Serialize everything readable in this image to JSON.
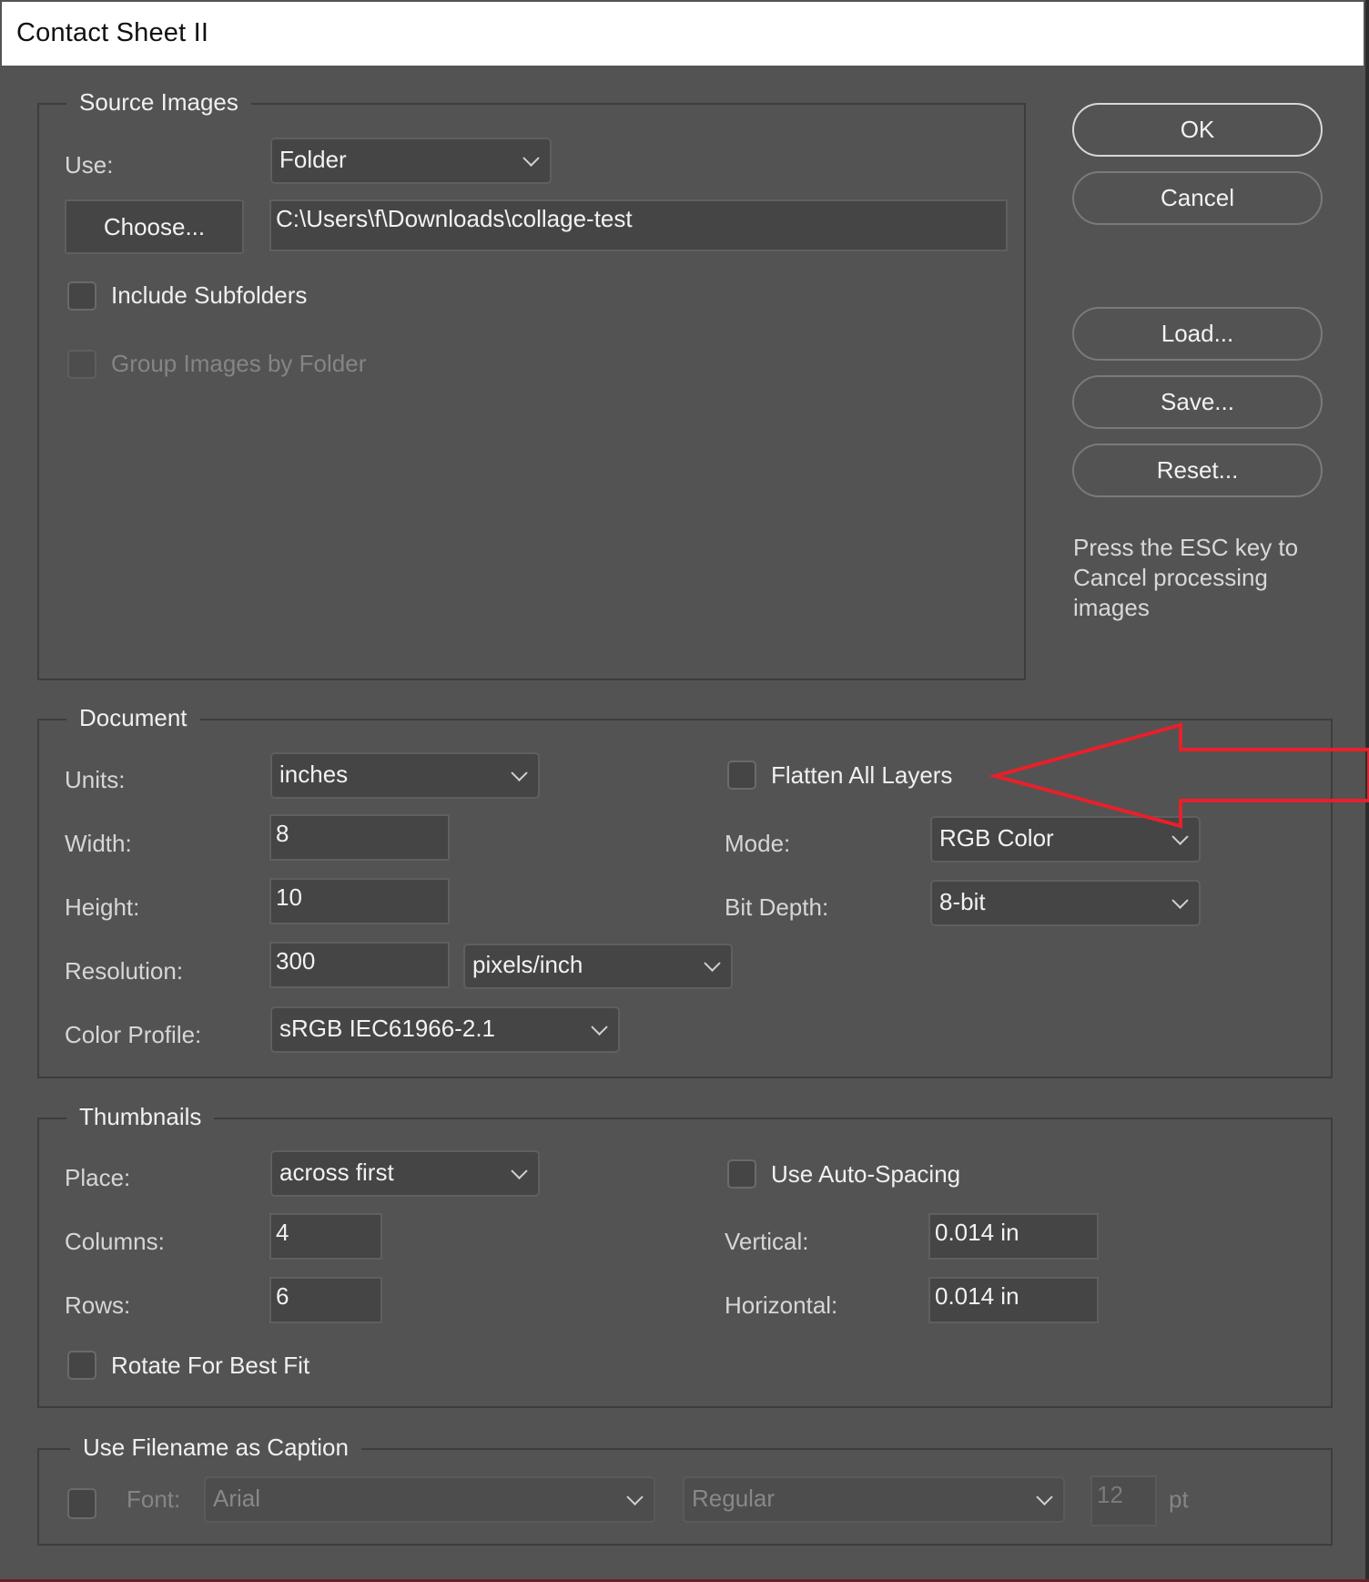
{
  "window": {
    "title": "Contact Sheet II"
  },
  "source_images": {
    "title": "Source Images",
    "use_label": "Use:",
    "use_value": "Folder",
    "choose_label": "Choose...",
    "path_value": "C:\\Users\\f\\Downloads\\collage-test",
    "include_subfolders": {
      "label": "Include Subfolders",
      "checked": false
    },
    "group_by_folder": {
      "label": "Group Images by Folder",
      "checked": false,
      "enabled": false
    }
  },
  "actions": {
    "ok": "OK",
    "cancel": "Cancel",
    "load": "Load...",
    "save": "Save...",
    "reset": "Reset...",
    "esc_note": "Press the ESC key to Cancel processing images"
  },
  "document": {
    "title": "Document",
    "units_label": "Units:",
    "units_value": "inches",
    "width_label": "Width:",
    "width_value": "8",
    "height_label": "Height:",
    "height_value": "10",
    "resolution_label": "Resolution:",
    "resolution_value": "300",
    "resolution_unit": "pixels/inch",
    "color_profile_label": "Color Profile:",
    "color_profile_value": "sRGB IEC61966-2.1",
    "flatten": {
      "label": "Flatten All Layers",
      "checked": false
    },
    "mode_label": "Mode:",
    "mode_value": "RGB Color",
    "bit_depth_label": "Bit Depth:",
    "bit_depth_value": "8-bit"
  },
  "thumbnails": {
    "title": "Thumbnails",
    "place_label": "Place:",
    "place_value": "across first",
    "columns_label": "Columns:",
    "columns_value": "4",
    "rows_label": "Rows:",
    "rows_value": "6",
    "rotate": {
      "label": "Rotate For Best Fit",
      "checked": false
    },
    "auto_spacing": {
      "label": "Use Auto-Spacing",
      "checked": false
    },
    "vertical_label": "Vertical:",
    "vertical_value": "0.014 in",
    "horizontal_label": "Horizontal:",
    "horizontal_value": "0.014 in"
  },
  "caption": {
    "title": "Use Filename as Caption",
    "enabled": false,
    "font_label": "Font:",
    "font_value": "Arial",
    "style_value": "Regular",
    "size_value": "12",
    "size_unit": "pt"
  },
  "annotation": {
    "type": "arrow",
    "color": "#e8202a",
    "points_to": "Flatten All Layers"
  }
}
